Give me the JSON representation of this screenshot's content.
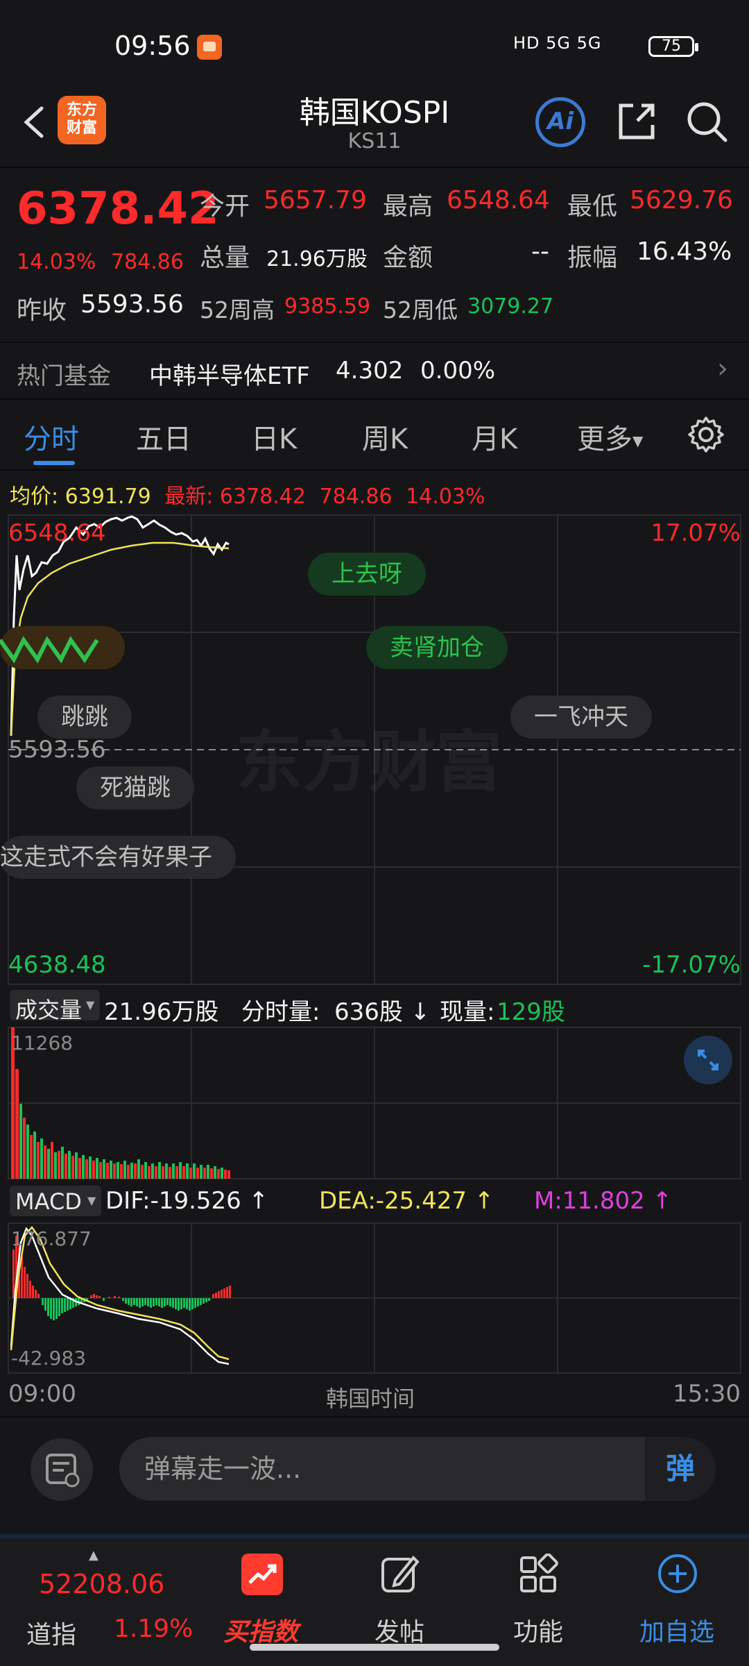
{
  "status_bar": {
    "time": "09:56",
    "network": "HD 5G 5G",
    "battery": "75"
  },
  "header": {
    "title": "韩国KOSPI",
    "code": "KS11",
    "logo_text": "东方财富"
  },
  "quote": {
    "price": "6378.42",
    "change_pct": "14.03%",
    "change_abs": "784.86",
    "open_label": "今开",
    "open": "5657.79",
    "high_label": "最高",
    "high": "6548.64",
    "low_label": "最低",
    "low": "5629.76",
    "volume_label": "总量",
    "volume": "21.96万股",
    "amount_label": "金额",
    "amount": "--",
    "amplitude_label": "振幅",
    "amplitude": "16.43%",
    "prev_close_label": "昨收",
    "prev_close": "5593.56",
    "w52_high_label": "52周高",
    "w52_high": "9385.59",
    "w52_low_label": "52周低",
    "w52_low": "3079.27"
  },
  "hot_fund": {
    "label": "热门基金",
    "name": "中韩半导体ETF",
    "price": "4.302",
    "change": "0.00%"
  },
  "tabs": [
    {
      "label": "分时"
    },
    {
      "label": "五日"
    },
    {
      "label": "日K"
    },
    {
      "label": "周K"
    },
    {
      "label": "月K"
    },
    {
      "label": "更多"
    }
  ],
  "avg_line": {
    "avg_label": "均价:",
    "avg": "6391.79",
    "latest_label": "最新:",
    "latest": "6378.42",
    "chg": "784.86",
    "pct": "14.03%"
  },
  "price_chart": {
    "top_price": "6548.64",
    "mid_price": "5593.56",
    "bottom_price": "4638.48",
    "top_pct": "17.07%",
    "bottom_pct": "-17.07%",
    "watermark": "东方财富"
  },
  "danmaku": [
    "上去呀",
    "卖肾加仓",
    "跳跳",
    "一飞冲天",
    "死猫跳",
    "这走式不会有好果子"
  ],
  "volume_bar": {
    "label": "成交量",
    "total": "21.96万股",
    "tick_label": "分时量:",
    "tick": "636股",
    "current_label": "现量:",
    "current": "129股",
    "max": "11268"
  },
  "macd": {
    "label": "MACD",
    "dif": "DIF:-19.526",
    "dea": "DEA:-25.427",
    "m": "M:11.802",
    "max": "176.877",
    "min": "-42.983"
  },
  "time_axis": {
    "start": "09:00",
    "mid": "韩国时间",
    "end": "15:30"
  },
  "input": {
    "placeholder": "弹幕走一波...",
    "toggle": "弹"
  },
  "bottom_nav": {
    "index_value": "52208.06",
    "index_name": "道指",
    "index_pct": "1.19%",
    "buy_index": "买指数",
    "post": "发帖",
    "functions": "功能",
    "add_watch": "加自选"
  },
  "colors": {
    "up": "#ff2a2a",
    "down": "#19c25a",
    "accent": "#3a8ee6",
    "avg_line": "#f2e35a",
    "macd_m": "#e040e0"
  }
}
